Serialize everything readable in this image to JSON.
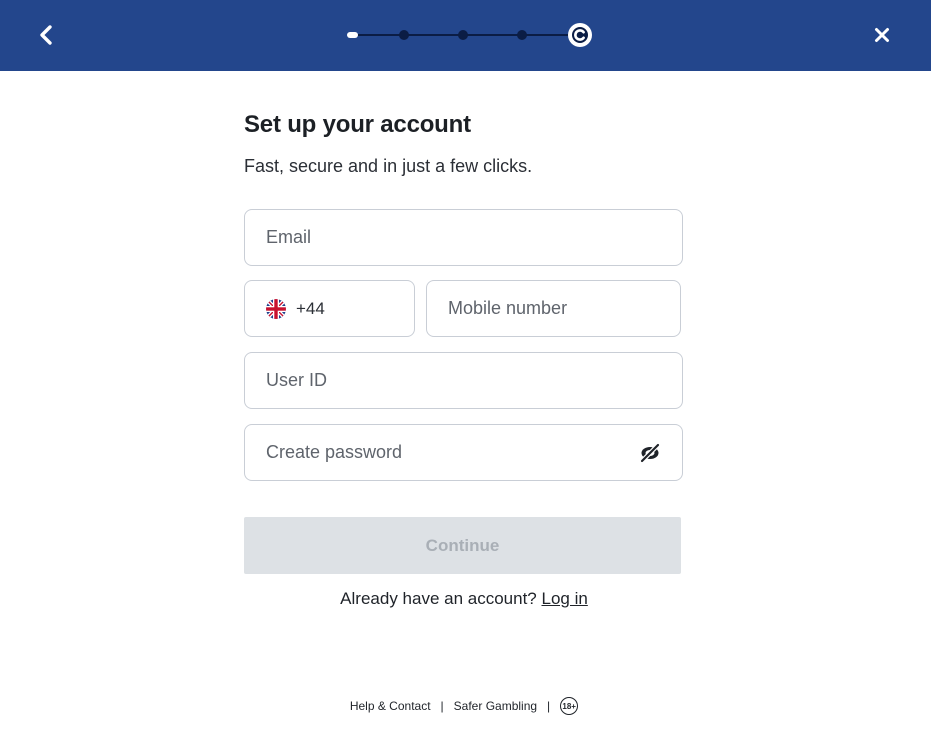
{
  "header": {
    "back_icon": "chevron-left-icon",
    "close_icon": "close-icon",
    "progress_current_icon": "brand-logo-icon",
    "colors": {
      "bar": "#23468c",
      "track": "#0b1d45"
    }
  },
  "form": {
    "title": "Set up your account",
    "subtitle": "Fast, secure and in just a few clicks.",
    "email_placeholder": "Email",
    "country_code": "+44",
    "country_flag": "uk-flag-icon",
    "mobile_placeholder": "Mobile number",
    "userid_placeholder": "User ID",
    "password_placeholder": "Create password",
    "password_toggle_icon": "eye-off-icon",
    "continue_label": "Continue",
    "continue_state": "disabled"
  },
  "login_prompt": {
    "text": "Already have an account?",
    "link": "Log in"
  },
  "footer": {
    "help": "Help & Contact",
    "safer": "Safer Gambling",
    "age_badge": "18+",
    "separator": "|"
  }
}
